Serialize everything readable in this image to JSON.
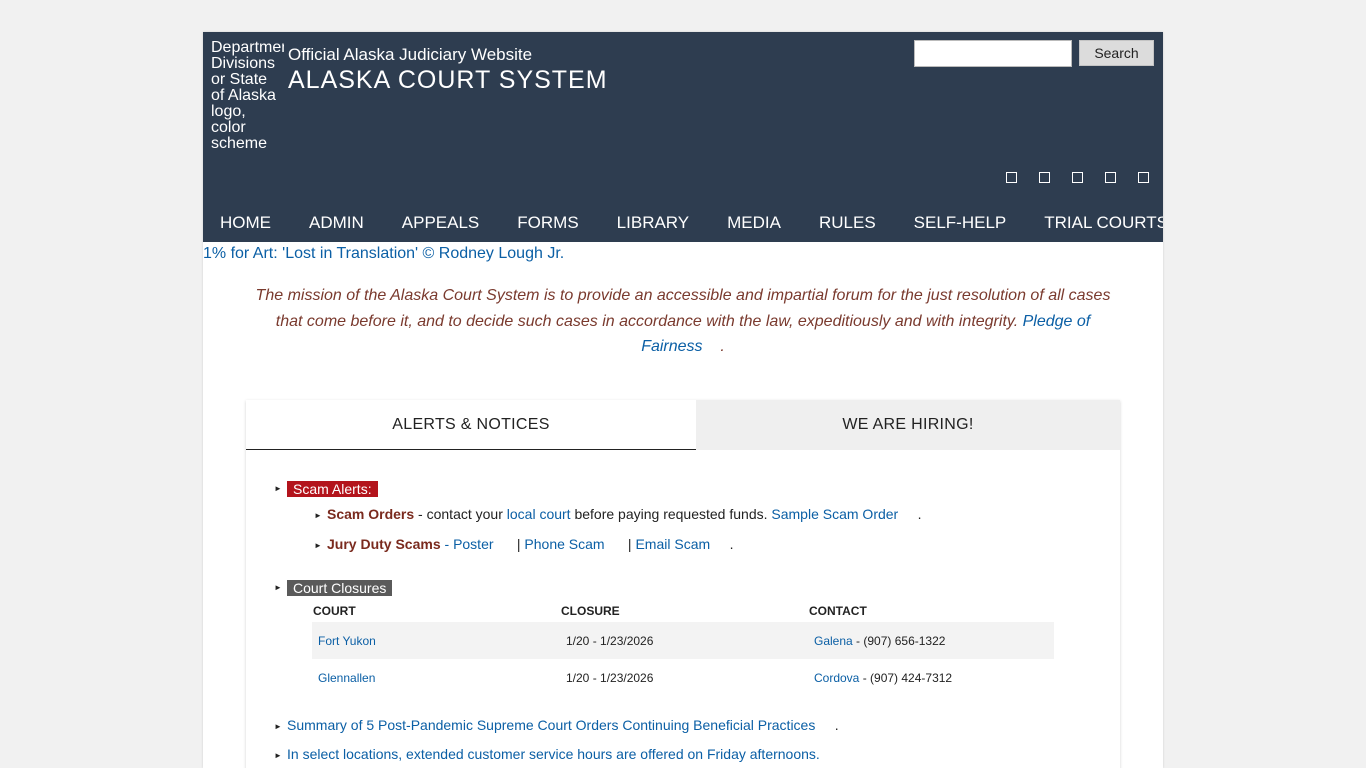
{
  "header": {
    "logo_alt": "Department Divisions or State of Alaska logo, color scheme",
    "official": "Official Alaska Judiciary Website",
    "site_name": "ALASKA COURT SYSTEM",
    "search_placeholder": "",
    "search_button": "Search",
    "social_icons": [
      "social-icon-1",
      "social-icon-2",
      "social-icon-3",
      "social-icon-4",
      "social-icon-5"
    ]
  },
  "nav": [
    "HOME",
    "ADMIN",
    "APPEALS",
    "FORMS",
    "LIBRARY",
    "MEDIA",
    "RULES",
    "SELF-HELP",
    "TRIAL COURTS"
  ],
  "banner_alt": "1% for Art: 'Lost in Translation' © Rodney Lough Jr.",
  "mission": {
    "text": "The mission of the Alaska Court System is to provide an accessible and impartial forum for the just resolution of all cases that come before it, and to decide such cases in accordance with the law, expeditiously and with integrity.",
    "link": "Pledge of Fairness",
    "end": "."
  },
  "tabs": {
    "alerts": "ALERTS & NOTICES",
    "hiring": "WE ARE HIRING!"
  },
  "alerts": {
    "scam_badge": "Scam Alerts:",
    "scam_orders_label": "Scam Orders",
    "scam_orders_text1": " - contact your ",
    "scam_orders_link1": "local court",
    "scam_orders_text2": " before paying requested funds. ",
    "scam_orders_link2": "Sample Scam Order",
    "scam_orders_end": ".",
    "jury_label": "Jury Duty Scams",
    "jury_dash": " - ",
    "jury_poster": "Poster",
    "jury_sep1": "|",
    "jury_phone": "Phone Scam",
    "jury_sep2": "|",
    "jury_email": "Email Scam",
    "jury_end": ".",
    "closures_badge": "Court Closures",
    "closures_headers": [
      "COURT",
      "CLOSURE",
      "CONTACT"
    ],
    "closures_rows": [
      {
        "court": "Fort Yukon",
        "closure": "1/20 - 1/23/2026",
        "contact_court": "Galena",
        "contact_phone": " - (907) 656-1322"
      },
      {
        "court": "Glennallen",
        "closure": "1/20 - 1/23/2026",
        "contact_court": "Cordova",
        "contact_phone": " - (907) 424-7312"
      }
    ],
    "summary_link": "Summary of 5 Post-Pandemic Supreme Court Orders Continuing Beneficial Practices",
    "summary_end": ".",
    "hours_link": "In select locations, extended customer service hours are offered on Friday afternoons."
  },
  "colors": {
    "header_bg": "#2e3d50",
    "scam_badge": "#b3141c",
    "closures_badge": "#5a5a5a",
    "link": "#0b5fa5",
    "mission_text": "#7a3a2e"
  }
}
